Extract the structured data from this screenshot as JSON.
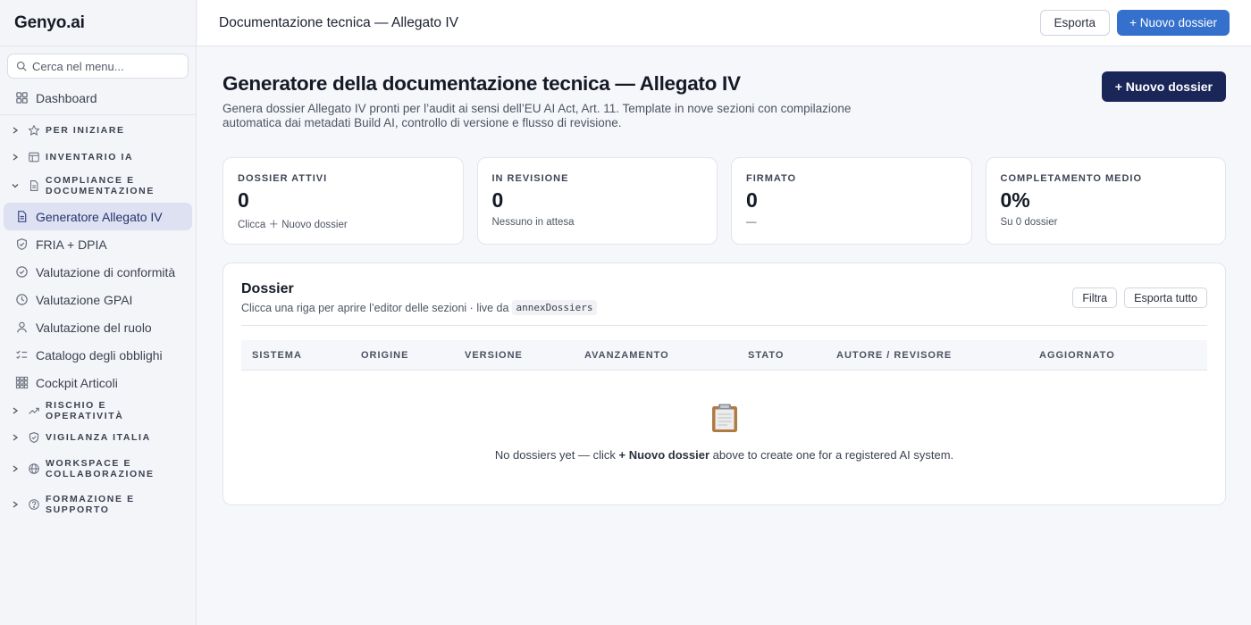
{
  "brand": "Genyo.ai",
  "search": {
    "placeholder": "Cerca nel menu..."
  },
  "sidebar": {
    "dashboard": "Dashboard",
    "sections": {
      "per_iniziare": "PER INIZIARE",
      "inventario": "INVENTARIO IA",
      "compliance_line1": "COMPLIANCE E",
      "compliance_line2": "DOCUMENTAZIONE",
      "rischio": "RISCHIO E OPERATIVITÀ",
      "vigilanza": "VIGILANZA ITALIA",
      "workspace_line1": "WORKSPACE E",
      "workspace_line2": "COLLABORAZIONE",
      "formazione_line1": "FORMAZIONE E",
      "formazione_line2": "SUPPORTO"
    },
    "items": [
      {
        "label": "Generatore Allegato IV",
        "icon": "document-icon"
      },
      {
        "label": "FRIA + DPIA",
        "icon": "shield-icon"
      },
      {
        "label": "Valutazione di conformità",
        "icon": "check-circle-icon"
      },
      {
        "label": "Valutazione GPAI",
        "icon": "clock-icon"
      },
      {
        "label": "Valutazione del ruolo",
        "icon": "user-icon"
      },
      {
        "label": "Catalogo degli obblighi",
        "icon": "checklist-icon"
      },
      {
        "label": "Cockpit Articoli",
        "icon": "grid-icon"
      }
    ]
  },
  "topbar": {
    "title": "Documentazione tecnica — Allegato IV",
    "export_label": "Esporta",
    "new_label": "+ Nuovo dossier"
  },
  "hero": {
    "title": "Generatore della documentazione tecnica — Allegato IV",
    "description": "Genera dossier Allegato IV pronti per l’audit ai sensi dell’EU AI Act, Art. 11. Template in nove sezioni con compilazione automatica dai metadati Build AI, controllo di versione e flusso di revisione.",
    "new_label": "+ Nuovo dossier"
  },
  "stats": [
    {
      "label": "DOSSIER ATTIVI",
      "value": "0",
      "sub": "Clicca ＋ Nuovo dossier"
    },
    {
      "label": "IN REVISIONE",
      "value": "0",
      "sub": "Nessuno in attesa"
    },
    {
      "label": "FIRMATO",
      "value": "0",
      "sub": "—"
    },
    {
      "label": "COMPLETAMENTO MEDIO",
      "value": "0%",
      "sub": "Su 0 dossier"
    }
  ],
  "panel": {
    "title": "Dossier",
    "subtitle": "Clicca una riga per aprire l’editor delle sezioni · live da",
    "code": "annexDossiers",
    "filter_label": "Filtra",
    "export_all_label": "Esporta tutto",
    "columns": [
      "SISTEMA",
      "ORIGINE",
      "VERSIONE",
      "AVANZAMENTO",
      "STATO",
      "AUTORE / REVISORE",
      "AGGIORNATO"
    ],
    "empty_pre": "No dossiers yet — click ",
    "empty_bold": "+ Nuovo dossier",
    "empty_post": " above to create one for a registered AI system."
  }
}
